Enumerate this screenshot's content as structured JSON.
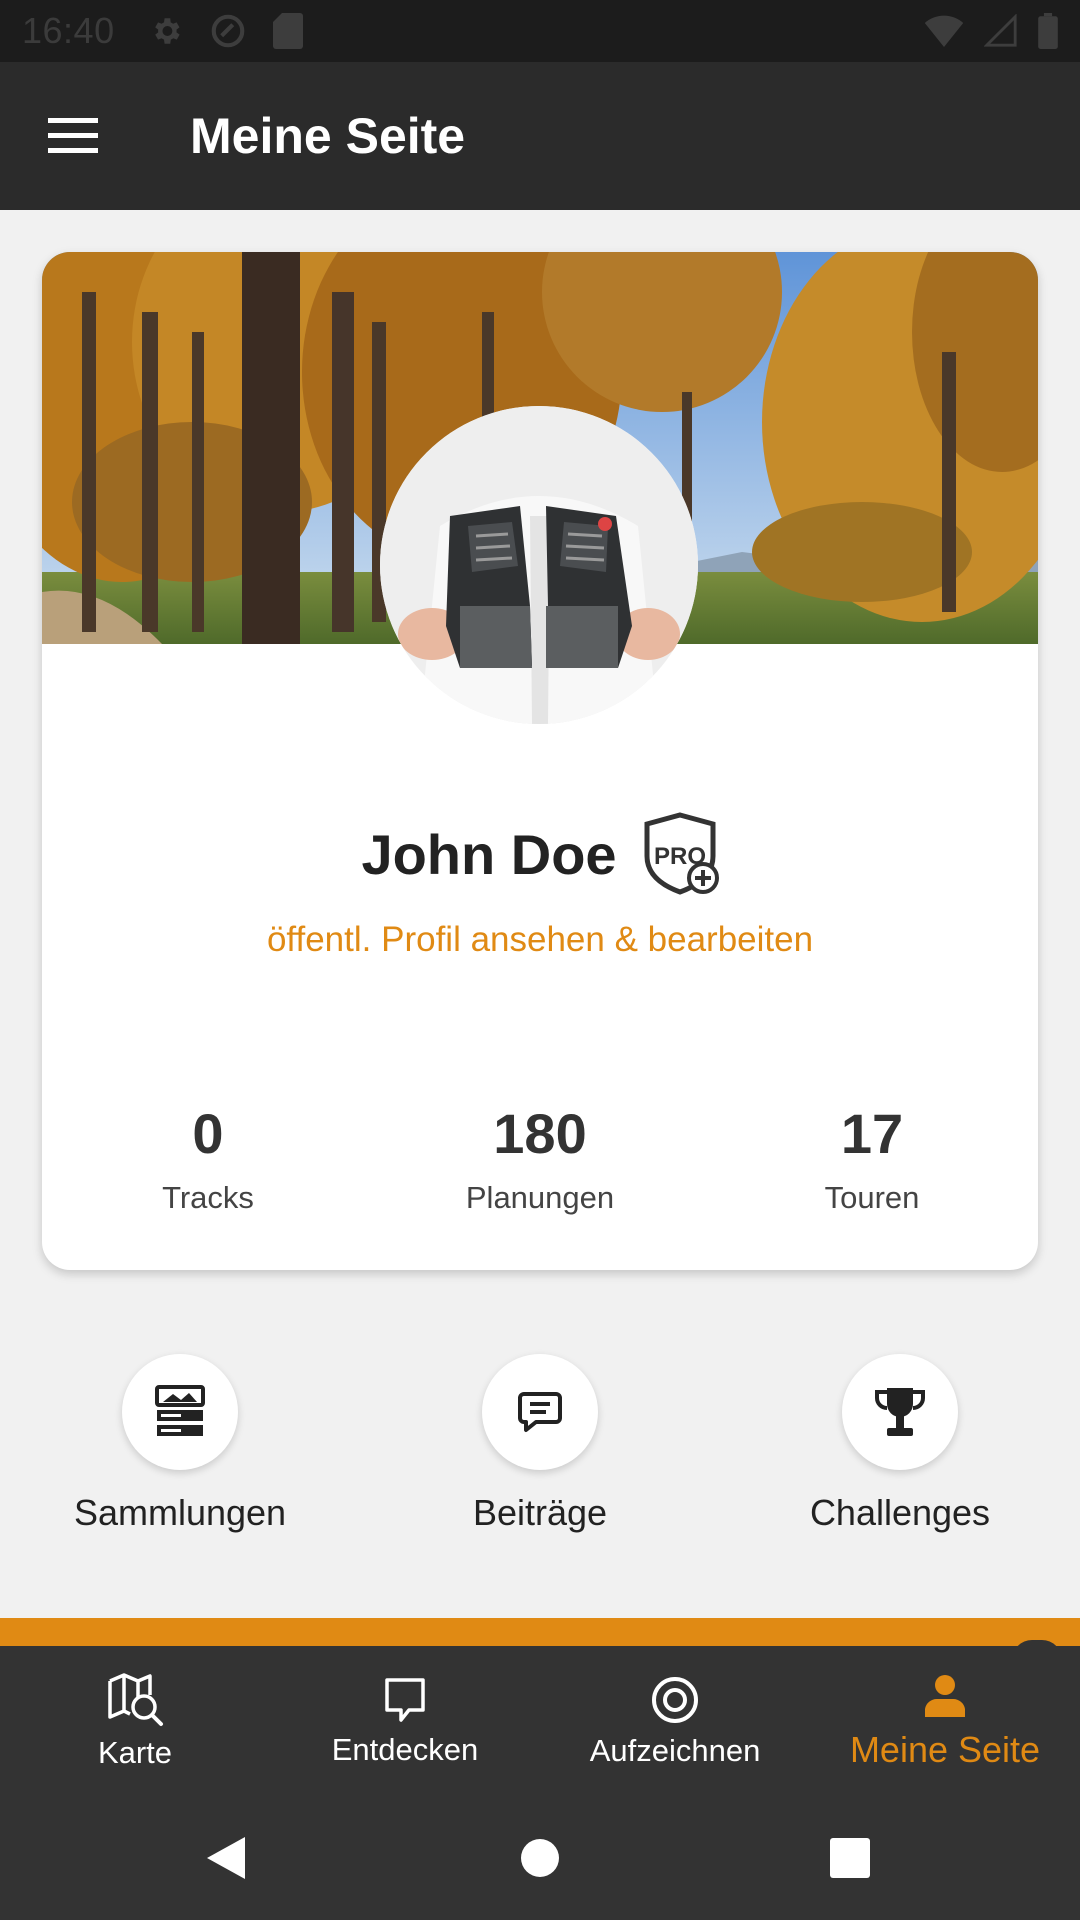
{
  "status_bar": {
    "time": "16:40",
    "left_icons": [
      "gear-icon",
      "sync-icon",
      "sd-card-icon"
    ],
    "right_icons": [
      "wifi-icon",
      "signal-icon",
      "battery-icon"
    ]
  },
  "app_bar": {
    "title": "Meine Seite",
    "menu_icon": "hamburger-menu-icon"
  },
  "profile": {
    "name": "John Doe",
    "badge": "PRO",
    "link_text": "öffentl. Profil ansehen & bearbeiten",
    "stats": [
      {
        "value": "0",
        "label": "Tracks"
      },
      {
        "value": "180",
        "label": "Planungen"
      },
      {
        "value": "17",
        "label": "Touren"
      }
    ]
  },
  "quick_actions": [
    {
      "label": "Sammlungen",
      "icon": "collections-icon"
    },
    {
      "label": "Beiträge",
      "icon": "comment-icon"
    },
    {
      "label": "Challenges",
      "icon": "trophy-icon"
    }
  ],
  "bottom_nav": [
    {
      "label": "Karte",
      "icon": "map-search-icon",
      "active": false
    },
    {
      "label": "Entdecken",
      "icon": "discover-icon",
      "active": false
    },
    {
      "label": "Aufzeichnen",
      "icon": "record-icon",
      "active": false
    },
    {
      "label": "Meine Seite",
      "icon": "person-icon",
      "active": true
    }
  ],
  "colors": {
    "accent": "#e08a14",
    "app_bar": "#2b2b2b",
    "nav_bar": "#333333",
    "background": "#f1f1f1"
  }
}
